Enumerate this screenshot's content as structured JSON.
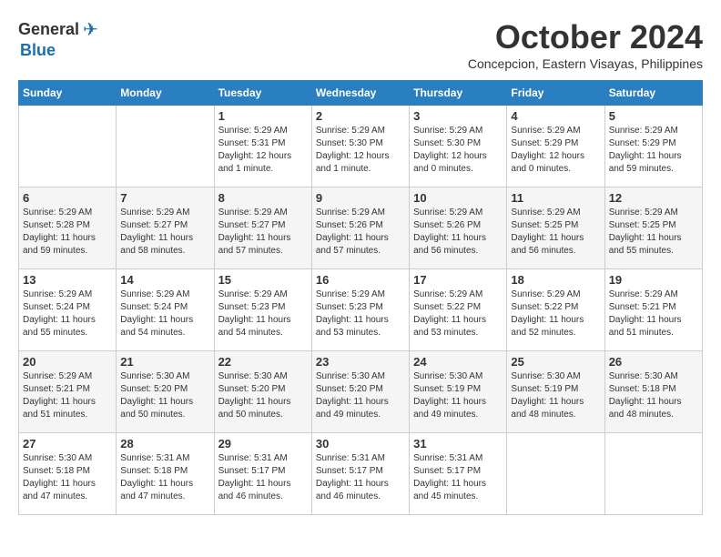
{
  "header": {
    "logo_general": "General",
    "logo_blue": "Blue",
    "month": "October 2024",
    "location": "Concepcion, Eastern Visayas, Philippines"
  },
  "weekdays": [
    "Sunday",
    "Monday",
    "Tuesday",
    "Wednesday",
    "Thursday",
    "Friday",
    "Saturday"
  ],
  "weeks": [
    [
      {
        "day": "",
        "info": ""
      },
      {
        "day": "",
        "info": ""
      },
      {
        "day": "1",
        "info": "Sunrise: 5:29 AM\nSunset: 5:31 PM\nDaylight: 12 hours\nand 1 minute."
      },
      {
        "day": "2",
        "info": "Sunrise: 5:29 AM\nSunset: 5:30 PM\nDaylight: 12 hours\nand 1 minute."
      },
      {
        "day": "3",
        "info": "Sunrise: 5:29 AM\nSunset: 5:30 PM\nDaylight: 12 hours\nand 0 minutes."
      },
      {
        "day": "4",
        "info": "Sunrise: 5:29 AM\nSunset: 5:29 PM\nDaylight: 12 hours\nand 0 minutes."
      },
      {
        "day": "5",
        "info": "Sunrise: 5:29 AM\nSunset: 5:29 PM\nDaylight: 11 hours\nand 59 minutes."
      }
    ],
    [
      {
        "day": "6",
        "info": "Sunrise: 5:29 AM\nSunset: 5:28 PM\nDaylight: 11 hours\nand 59 minutes."
      },
      {
        "day": "7",
        "info": "Sunrise: 5:29 AM\nSunset: 5:27 PM\nDaylight: 11 hours\nand 58 minutes."
      },
      {
        "day": "8",
        "info": "Sunrise: 5:29 AM\nSunset: 5:27 PM\nDaylight: 11 hours\nand 57 minutes."
      },
      {
        "day": "9",
        "info": "Sunrise: 5:29 AM\nSunset: 5:26 PM\nDaylight: 11 hours\nand 57 minutes."
      },
      {
        "day": "10",
        "info": "Sunrise: 5:29 AM\nSunset: 5:26 PM\nDaylight: 11 hours\nand 56 minutes."
      },
      {
        "day": "11",
        "info": "Sunrise: 5:29 AM\nSunset: 5:25 PM\nDaylight: 11 hours\nand 56 minutes."
      },
      {
        "day": "12",
        "info": "Sunrise: 5:29 AM\nSunset: 5:25 PM\nDaylight: 11 hours\nand 55 minutes."
      }
    ],
    [
      {
        "day": "13",
        "info": "Sunrise: 5:29 AM\nSunset: 5:24 PM\nDaylight: 11 hours\nand 55 minutes."
      },
      {
        "day": "14",
        "info": "Sunrise: 5:29 AM\nSunset: 5:24 PM\nDaylight: 11 hours\nand 54 minutes."
      },
      {
        "day": "15",
        "info": "Sunrise: 5:29 AM\nSunset: 5:23 PM\nDaylight: 11 hours\nand 54 minutes."
      },
      {
        "day": "16",
        "info": "Sunrise: 5:29 AM\nSunset: 5:23 PM\nDaylight: 11 hours\nand 53 minutes."
      },
      {
        "day": "17",
        "info": "Sunrise: 5:29 AM\nSunset: 5:22 PM\nDaylight: 11 hours\nand 53 minutes."
      },
      {
        "day": "18",
        "info": "Sunrise: 5:29 AM\nSunset: 5:22 PM\nDaylight: 11 hours\nand 52 minutes."
      },
      {
        "day": "19",
        "info": "Sunrise: 5:29 AM\nSunset: 5:21 PM\nDaylight: 11 hours\nand 51 minutes."
      }
    ],
    [
      {
        "day": "20",
        "info": "Sunrise: 5:29 AM\nSunset: 5:21 PM\nDaylight: 11 hours\nand 51 minutes."
      },
      {
        "day": "21",
        "info": "Sunrise: 5:30 AM\nSunset: 5:20 PM\nDaylight: 11 hours\nand 50 minutes."
      },
      {
        "day": "22",
        "info": "Sunrise: 5:30 AM\nSunset: 5:20 PM\nDaylight: 11 hours\nand 50 minutes."
      },
      {
        "day": "23",
        "info": "Sunrise: 5:30 AM\nSunset: 5:20 PM\nDaylight: 11 hours\nand 49 minutes."
      },
      {
        "day": "24",
        "info": "Sunrise: 5:30 AM\nSunset: 5:19 PM\nDaylight: 11 hours\nand 49 minutes."
      },
      {
        "day": "25",
        "info": "Sunrise: 5:30 AM\nSunset: 5:19 PM\nDaylight: 11 hours\nand 48 minutes."
      },
      {
        "day": "26",
        "info": "Sunrise: 5:30 AM\nSunset: 5:18 PM\nDaylight: 11 hours\nand 48 minutes."
      }
    ],
    [
      {
        "day": "27",
        "info": "Sunrise: 5:30 AM\nSunset: 5:18 PM\nDaylight: 11 hours\nand 47 minutes."
      },
      {
        "day": "28",
        "info": "Sunrise: 5:31 AM\nSunset: 5:18 PM\nDaylight: 11 hours\nand 47 minutes."
      },
      {
        "day": "29",
        "info": "Sunrise: 5:31 AM\nSunset: 5:17 PM\nDaylight: 11 hours\nand 46 minutes."
      },
      {
        "day": "30",
        "info": "Sunrise: 5:31 AM\nSunset: 5:17 PM\nDaylight: 11 hours\nand 46 minutes."
      },
      {
        "day": "31",
        "info": "Sunrise: 5:31 AM\nSunset: 5:17 PM\nDaylight: 11 hours\nand 45 minutes."
      },
      {
        "day": "",
        "info": ""
      },
      {
        "day": "",
        "info": ""
      }
    ]
  ]
}
